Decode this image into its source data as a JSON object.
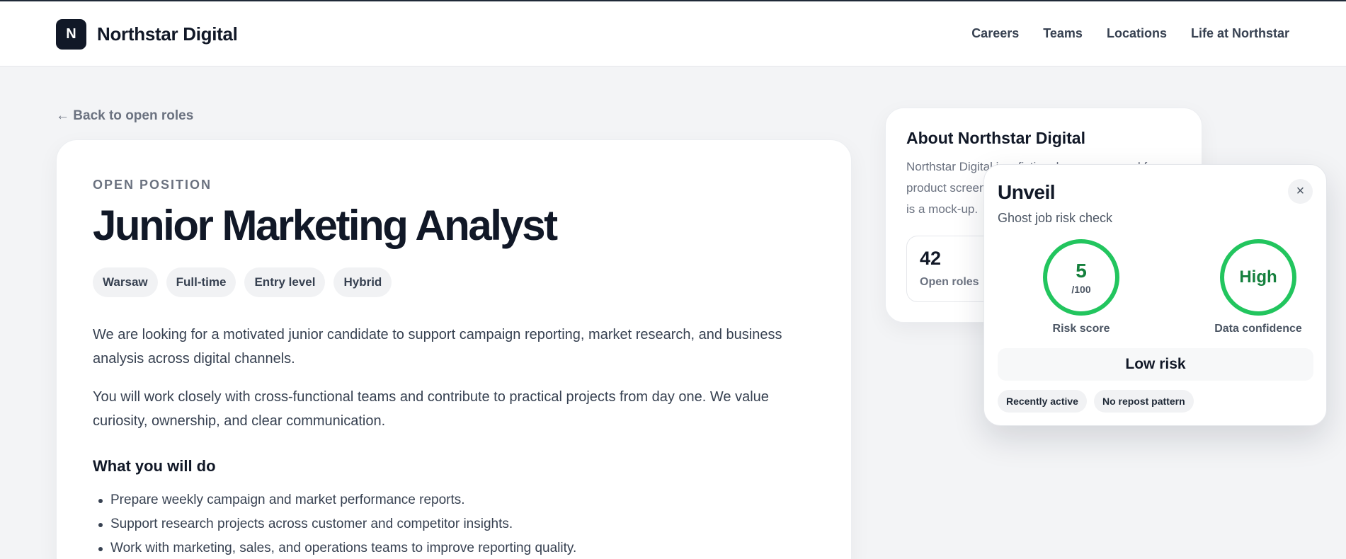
{
  "header": {
    "logo_letter": "N",
    "brand": "Northstar Digital",
    "nav": [
      "Careers",
      "Teams",
      "Locations",
      "Life at Northstar"
    ]
  },
  "back_link": "← Back to open roles",
  "job": {
    "eyebrow": "OPEN POSITION",
    "title": "Junior Marketing Analyst",
    "tags": [
      "Warsaw",
      "Full-time",
      "Entry level",
      "Hybrid"
    ],
    "paragraphs": [
      "We are looking for a motivated junior candidate to support campaign reporting, market research, and business analysis across digital channels.",
      "You will work closely with cross-functional teams and contribute to practical projects from day one. We value curiosity, ownership, and clear communication."
    ],
    "section_title": "What you will do",
    "bullets": [
      "Prepare weekly campaign and market performance reports.",
      "Support research projects across customer and competitor insights.",
      "Work with marketing, sales, and operations teams to improve reporting quality."
    ]
  },
  "about": {
    "title": "About Northstar Digital",
    "text": "Northstar Digital is a fictional company used for product screenshots and demos. This career page is a mock-up.",
    "stat_value": "42",
    "stat_label": "Open roles"
  },
  "unveil": {
    "title": "Unveil",
    "subtitle": "Ghost job risk check",
    "close_symbol": "×",
    "risk_score": "5",
    "risk_score_max": "/100",
    "risk_label": "Risk score",
    "confidence_value": "High",
    "confidence_label": "Data confidence",
    "verdict": "Low risk",
    "signals": [
      "Recently active",
      "No repost pattern"
    ],
    "accent_color": "#22c55e"
  }
}
